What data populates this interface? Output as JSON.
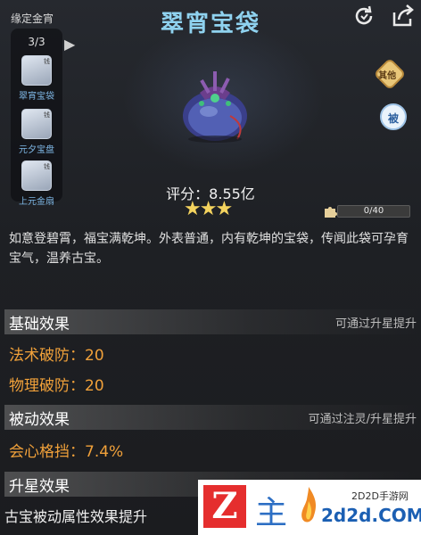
{
  "header": {
    "title": "翠宵宝袋"
  },
  "bound": {
    "label": "缘定金宵",
    "count": "3/3",
    "items": [
      {
        "name": "翠宵宝袋",
        "badge": "钱"
      },
      {
        "name": "元夕宝盘",
        "badge": "钱"
      },
      {
        "name": "上元金扇",
        "badge": "钱"
      }
    ]
  },
  "right_buttons": {
    "other": "其他",
    "passive": "被"
  },
  "item": {
    "score_text": "评分：8.55亿",
    "stars": 3,
    "star_glyphs": "★★★",
    "shard_progress_text": "0/40",
    "shard_progress_fraction": 0,
    "description": "如意登碧霄，福宝满乾坤。外表普通，内有乾坤的宝袋，传闻此袋可孕育宝气，温养古宝。"
  },
  "sections": {
    "basic": {
      "title": "基础效果",
      "note": "可通过升星提升",
      "stats": [
        "法术破防：20",
        "物理破防：20"
      ]
    },
    "passive": {
      "title": "被动效果",
      "note": "可通过注灵/升星提升",
      "stats": [
        "会心格挡：7.4%"
      ]
    },
    "star": {
      "title": "升星效果",
      "desc": "古宝被动属性效果提升"
    }
  },
  "watermark": {
    "logo_letter": "Z",
    "zhu": "主",
    "site": "2d2d.COM",
    "tag": "2D2D手游网"
  },
  "colors": {
    "title": "#8fd2ef",
    "stat": "#f1a13a",
    "star": "#f4d35e",
    "progress": "#d9a441"
  }
}
